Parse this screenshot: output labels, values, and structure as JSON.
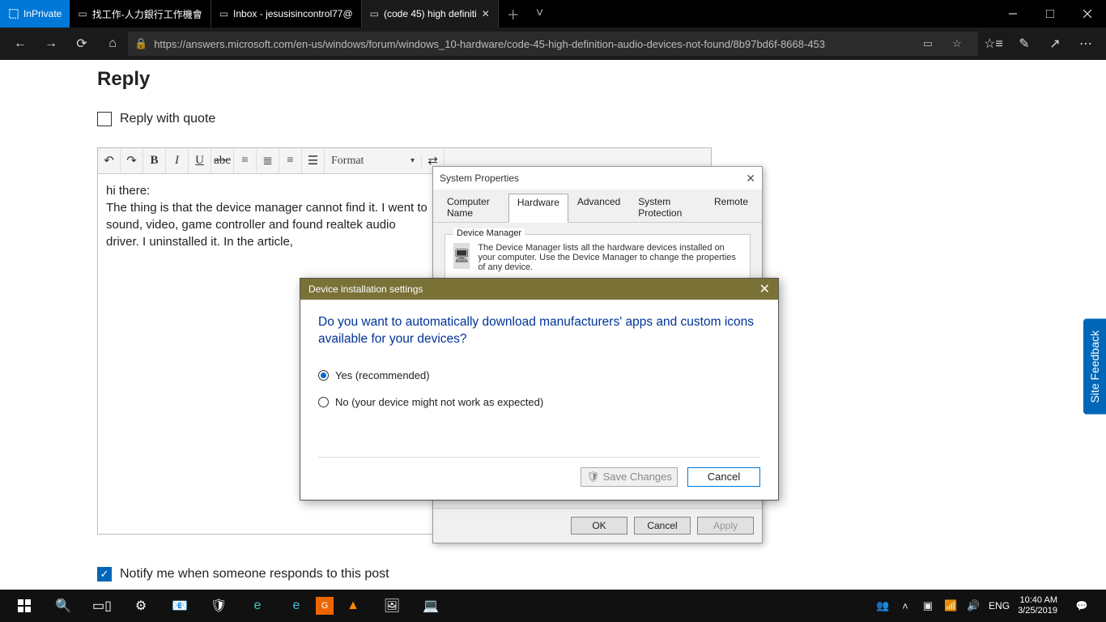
{
  "browser": {
    "inprivate": "InPrivate",
    "tabs": [
      {
        "label": "找工作-人力銀行工作機會"
      },
      {
        "label": "Inbox - jesusisincontrol77@"
      },
      {
        "label": "(code 45) high definiti"
      }
    ],
    "url": "https://answers.microsoft.com/en-us/windows/forum/windows_10-hardware/code-45-high-definition-audio-devices-not-found/8b97bd6f-8668-453"
  },
  "page": {
    "reply_heading": "Reply",
    "reply_with_quote": "Reply with quote",
    "toolbar": {
      "format": "Format"
    },
    "editor_lines": {
      "l1": "hi there:",
      "l2": "The thing is that the device manager cannot find it. I went to sound, video, game controller and found realtek audio driver. I uninstalled it. In the article,"
    },
    "notify": "Notify me when someone responds to this post",
    "feedback": "Site Feedback"
  },
  "sys_props": {
    "title": "System Properties",
    "tabs": {
      "computer_name": "Computer Name",
      "hardware": "Hardware",
      "advanced": "Advanced",
      "system_protection": "System Protection",
      "remote": "Remote"
    },
    "dm_legend": "Device Manager",
    "dm_text": "The Device Manager lists all the hardware devices installed on your computer. Use the Device Manager to change the properties of any device.",
    "ok": "OK",
    "cancel": "Cancel",
    "apply": "Apply"
  },
  "dev_install": {
    "title": "Device installation settings",
    "question": "Do you want to automatically download manufacturers' apps and custom icons available for your devices?",
    "yes": "Yes (recommended)",
    "no": "No (your device might not work as expected)",
    "save": "Save Changes",
    "cancel": "Cancel"
  },
  "tray": {
    "lang": "ENG",
    "time": "10:40 AM",
    "date": "3/25/2019"
  }
}
